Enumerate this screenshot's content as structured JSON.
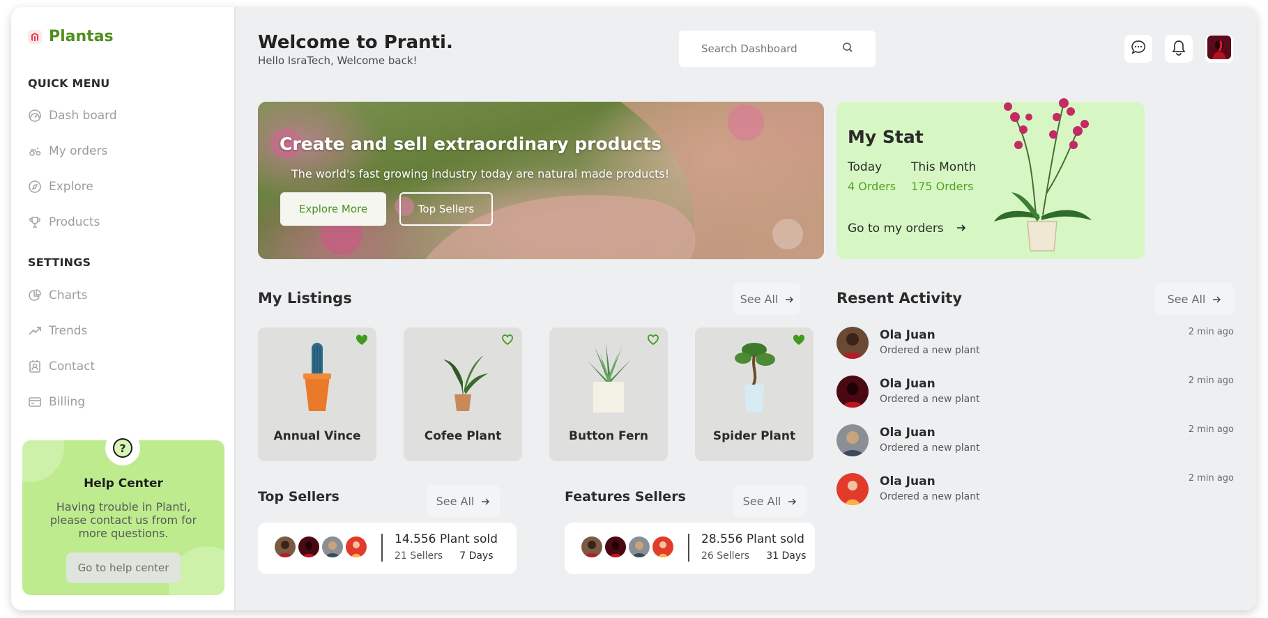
{
  "brand": {
    "name": "Plantas",
    "logo_icon": "magento-like-logo",
    "color": "#4f8f1e"
  },
  "sidebar": {
    "quick_menu_heading": "QUICK MENU",
    "quick_items": [
      {
        "label": "Dash board",
        "icon": "gauge-icon"
      },
      {
        "label": "My orders",
        "icon": "orders-icon"
      },
      {
        "label": "Explore",
        "icon": "compass-icon"
      },
      {
        "label": "Products",
        "icon": "trophy-icon"
      }
    ],
    "settings_heading": "SETTINGS",
    "settings_items": [
      {
        "label": "Charts",
        "icon": "pie-chart-icon"
      },
      {
        "label": "Trends",
        "icon": "trend-icon"
      },
      {
        "label": "Contact",
        "icon": "contact-icon"
      },
      {
        "label": "Billing",
        "icon": "billing-icon"
      }
    ]
  },
  "help": {
    "icon": "?",
    "title": "Help Center",
    "text": "Having trouble in Planti, please contact us from for more questions.",
    "button": "Go to help center"
  },
  "header": {
    "title": "Welcome to Pranti.",
    "subtitle": "Hello IsraTech, Welcome back!",
    "search_placeholder": "Search Dashboard"
  },
  "banner": {
    "title": "Create and sell extraordinary products",
    "subtitle": "The world's fast growing industry today are natural made products!",
    "primary_button": "Explore More",
    "secondary_button": "Top Sellers"
  },
  "stat": {
    "title": "My Stat",
    "today_label": "Today",
    "today_value": "4 Orders",
    "month_label": "This Month",
    "month_value": "175 Orders",
    "link": "Go to my orders"
  },
  "listings": {
    "title": "My Listings",
    "see_all": "See All",
    "items": [
      {
        "name": "Annual Vince",
        "favorite": true
      },
      {
        "name": "Cofee Plant",
        "favorite": false
      },
      {
        "name": "Button Fern",
        "favorite": false
      },
      {
        "name": "Spider Plant",
        "favorite": true
      }
    ]
  },
  "top_sellers": {
    "title": "Top Sellers",
    "see_all": "See All",
    "sold": "14.556 Plant sold",
    "sellers": "21 Sellers",
    "days": "7 Days"
  },
  "feature_sellers": {
    "title": "Features Sellers",
    "see_all": "See All",
    "sold": "28.556 Plant sold",
    "sellers": "26 Sellers",
    "days": "31 Days"
  },
  "activity": {
    "title": "Resent Activity",
    "see_all": "See All",
    "items": [
      {
        "name": "Ola Juan",
        "desc": "Ordered a new plant",
        "time": "2 min ago"
      },
      {
        "name": "Ola Juan",
        "desc": "Ordered a new plant",
        "time": "2 min ago"
      },
      {
        "name": "Ola Juan",
        "desc": "Ordered a new plant",
        "time": "2 min ago"
      },
      {
        "name": "Ola Juan",
        "desc": "Ordered a new plant",
        "time": "2 min ago"
      }
    ]
  },
  "colors": {
    "accent_green": "#4f8f1e",
    "stat_bg": "#d6f7c4",
    "help_bg": "#bdeb8e",
    "heart": "#3f9a1d"
  }
}
